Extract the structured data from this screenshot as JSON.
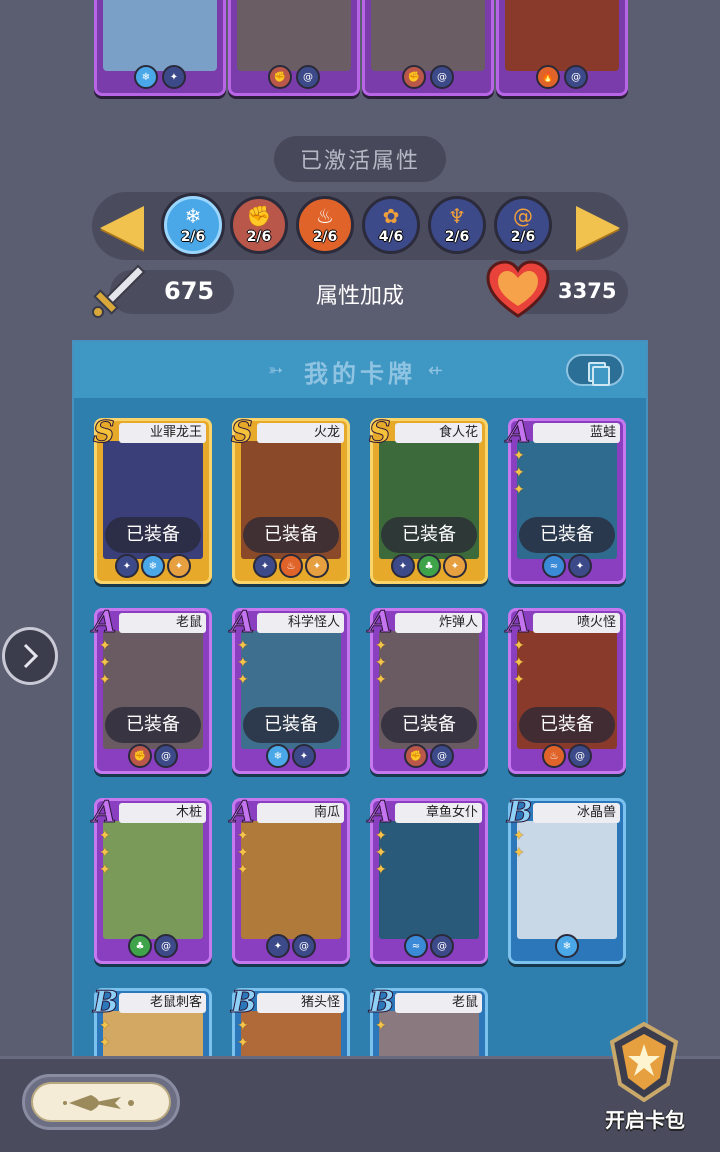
{
  "colors": {
    "background": "#5b5d70",
    "panel": "#2e7fae",
    "rank_s": "#e7a92a",
    "rank_a": "#8a3fc0",
    "rank_b": "#2b77b9",
    "accent_gold": "#f1c24e"
  },
  "top_row_badges": [
    [
      "ice-blue",
      "claw-orange"
    ],
    [
      "fist-red",
      "swirl-blue"
    ],
    [
      "fist-red",
      "swirl-blue"
    ],
    [
      "fire-orange",
      "swirl-blue"
    ]
  ],
  "activated": {
    "title": "已激活属性",
    "prev_icon": "left-arrow-icon",
    "next_icon": "right-arrow-icon",
    "attributes": [
      {
        "icon": "ice-crystal-icon",
        "count": "2/6",
        "color": "#4aa8e8",
        "selected": true
      },
      {
        "icon": "fist-icon",
        "count": "2/6",
        "color": "#b8574a",
        "selected": false
      },
      {
        "icon": "fire-icon",
        "count": "2/6",
        "color": "#e0642a",
        "selected": false
      },
      {
        "icon": "paw-icon",
        "count": "4/6",
        "color": "#3d4a8a",
        "selected": false
      },
      {
        "icon": "claw-icon",
        "count": "2/6",
        "color": "#3d4a8a",
        "selected": false
      },
      {
        "icon": "swirl-icon",
        "count": "2/6",
        "color": "#3d4a8a",
        "selected": false
      }
    ]
  },
  "stats": {
    "attack_icon": "sword-icon",
    "attack": "675",
    "bonus_label": "属性加成",
    "hp_icon": "heart-icon",
    "hp": "3375"
  },
  "panel": {
    "title": "我的卡牌",
    "toggle_icon": "cards-toggle-icon"
  },
  "cards": [
    {
      "rank": "S",
      "name": "业罪龙王",
      "stars": 0,
      "equipped": "已装备",
      "badges": [
        "claw",
        "ice",
        "claw-gold"
      ],
      "art": "#3a3f7a"
    },
    {
      "rank": "S",
      "name": "火龙",
      "stars": 0,
      "equipped": "已装备",
      "badges": [
        "claw",
        "fire",
        "claw-gold"
      ],
      "art": "#8a4a2a"
    },
    {
      "rank": "S",
      "name": "食人花",
      "stars": 0,
      "equipped": "已装备",
      "badges": [
        "claw",
        "leaf",
        "claw-gold"
      ],
      "art": "#3d6a3a"
    },
    {
      "rank": "A",
      "name": "蓝蛙",
      "stars": 3,
      "equipped": "已装备",
      "badges": [
        "wave",
        "claw"
      ],
      "art": "#2f6a8f"
    },
    {
      "rank": "A",
      "name": "老鼠",
      "stars": 3,
      "equipped": "已装备",
      "badges": [
        "fist",
        "swirl"
      ],
      "art": "#6a5a62"
    },
    {
      "rank": "A",
      "name": "科学怪人",
      "stars": 3,
      "equipped": "已装备",
      "badges": [
        "ice",
        "claw"
      ],
      "art": "#3f6f8f"
    },
    {
      "rank": "A",
      "name": "炸弹人",
      "stars": 3,
      "equipped": "已装备",
      "badges": [
        "fist",
        "swirl"
      ],
      "art": "#6a5a62"
    },
    {
      "rank": "A",
      "name": "喷火怪",
      "stars": 3,
      "equipped": "已装备",
      "badges": [
        "fire",
        "swirl"
      ],
      "art": "#8a3a2a"
    },
    {
      "rank": "A",
      "name": "木桩",
      "stars": 3,
      "equipped": "",
      "badges": [
        "leaf",
        "swirl"
      ],
      "art": "#7a9a5a"
    },
    {
      "rank": "A",
      "name": "南瓜",
      "stars": 3,
      "equipped": "",
      "badges": [
        "claw",
        "swirl"
      ],
      "art": "#b07a3a"
    },
    {
      "rank": "A",
      "name": "章鱼女仆",
      "stars": 3,
      "equipped": "",
      "badges": [
        "wave",
        "swirl"
      ],
      "art": "#2a5a7a"
    },
    {
      "rank": "B",
      "name": "冰晶兽",
      "stars": 2,
      "equipped": "",
      "badges": [
        "ice"
      ],
      "art": "#c9d8e6"
    },
    {
      "rank": "B",
      "name": "老鼠刺客",
      "stars": 2,
      "equipped": "",
      "badges": [],
      "art": "#d3a863"
    },
    {
      "rank": "B",
      "name": "猪头怪",
      "stars": 2,
      "equipped": "",
      "badges": [],
      "art": "#b06a3a"
    },
    {
      "rank": "B",
      "name": "老鼠",
      "stars": 1,
      "equipped": "",
      "badges": [],
      "art": "#8a7a80"
    }
  ],
  "bottom": {
    "open_pack_label": "开启卡包",
    "pack_icon": "card-pack-icon",
    "left_button_icon": "fish-emblem-icon"
  },
  "side_button_icon": "chevron-right-icon"
}
